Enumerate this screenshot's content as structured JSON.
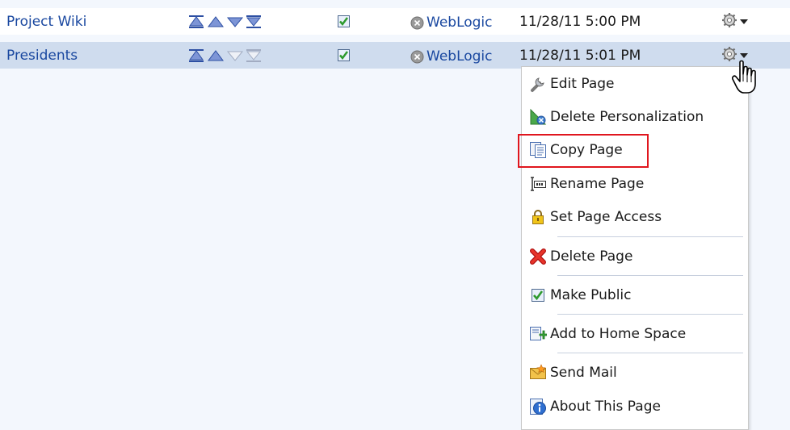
{
  "rows": [
    {
      "name": "Project Wiki",
      "server": "WebLogic",
      "date": "11/28/11 5:00 PM",
      "reorder_enabled": [
        true,
        true,
        true,
        true
      ]
    },
    {
      "name": "Presidents",
      "server": "WebLogic",
      "date": "11/28/11 5:01 PM",
      "reorder_enabled": [
        true,
        true,
        false,
        false
      ]
    }
  ],
  "menu": {
    "items": [
      {
        "label": "Edit Page",
        "icon": "wrench-icon"
      },
      {
        "label": "Delete Personalization",
        "icon": "delete-personalization-icon"
      },
      {
        "label": "Copy Page",
        "icon": "copy-icon",
        "highlighted": true
      },
      {
        "label": "Rename Page",
        "icon": "rename-icon"
      },
      {
        "label": "Set Page Access",
        "icon": "lock-icon"
      },
      {
        "label": "Delete Page",
        "icon": "red-x-icon"
      },
      {
        "label": "Make Public",
        "icon": "checkbox-icon"
      },
      {
        "label": "Add to Home Space",
        "icon": "add-home-icon"
      },
      {
        "label": "Send Mail",
        "icon": "mail-icon"
      },
      {
        "label": "About This Page",
        "icon": "info-icon"
      }
    ]
  },
  "colors": {
    "link": "#1a48a0",
    "selected_row": "#cfdcee",
    "highlight_border": "#e0161e"
  }
}
